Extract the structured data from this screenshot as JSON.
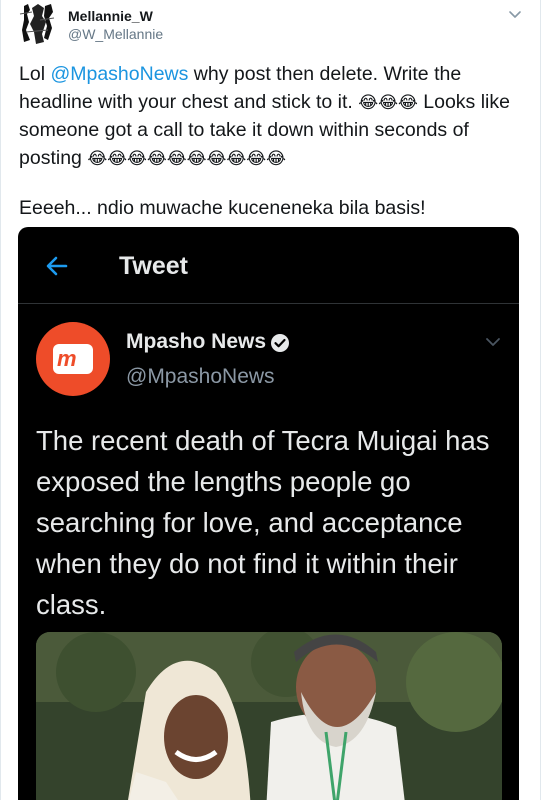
{
  "author": {
    "display_name": "Mellannie_W",
    "handle": "@W_Mellannie",
    "avatar_icon": "profile-avatar"
  },
  "tweet": {
    "text_before_mention": "Lol ",
    "mention": "@MpashoNews",
    "text_after_mention_1": " why post then delete. Write the headline with your chest and stick to it. ",
    "emoji_group_1": "😂😂😂",
    "text_after_emoji_1": " Looks like someone got a call to take it down within seconds of posting ",
    "emoji_group_2": "😂😂😂😂😂😂😂😂😂😂",
    "second_paragraph": "Eeeeh... ndio muwache kuceneneka bila basis!",
    "mention_color": "#1b95e0"
  },
  "screenshot": {
    "header_title": "Tweet",
    "back_icon": "back-arrow-icon",
    "account_name": "Mpasho News",
    "account_handle": "@MpashoNews",
    "logo_mark": "m",
    "logo_color": "#ee4c29",
    "verified_icon": "verified-badge-icon",
    "text": "The recent death of Tecra Muigai has exposed the lengths people go searching for love, and acceptance when they do not find it within their class.",
    "background_color": "#000000"
  }
}
